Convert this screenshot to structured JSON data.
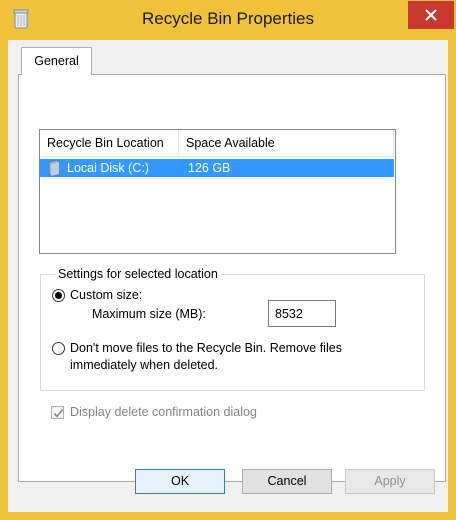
{
  "window": {
    "title": "Recycle Bin Properties",
    "app_icon": "recycle-bin-icon",
    "close_icon": "close-icon",
    "colors": {
      "frame": "#f0c23b",
      "close": "#c7392f",
      "selection": "#3399ff"
    }
  },
  "tabs": [
    {
      "label": "General",
      "selected": true
    }
  ],
  "list": {
    "columns": [
      "Recycle Bin Location",
      "Space Available"
    ],
    "rows": [
      {
        "location": "Local Disk (C:)",
        "space": "126 GB",
        "icon": "drive-icon",
        "selected": true
      }
    ]
  },
  "settings": {
    "legend": "Settings for selected location",
    "custom_size": {
      "label": "Custom size:",
      "selected": true
    },
    "max_size": {
      "label": "Maximum size (MB):",
      "value": "8532"
    },
    "dont_move": {
      "line1": "Don't move files to the Recycle Bin. Remove files",
      "line2": "immediately when deleted.",
      "selected": false
    }
  },
  "confirm": {
    "label": "Display delete confirmation dialog",
    "checked": true,
    "enabled": false
  },
  "buttons": {
    "ok": "OK",
    "cancel": "Cancel",
    "apply": "Apply"
  }
}
